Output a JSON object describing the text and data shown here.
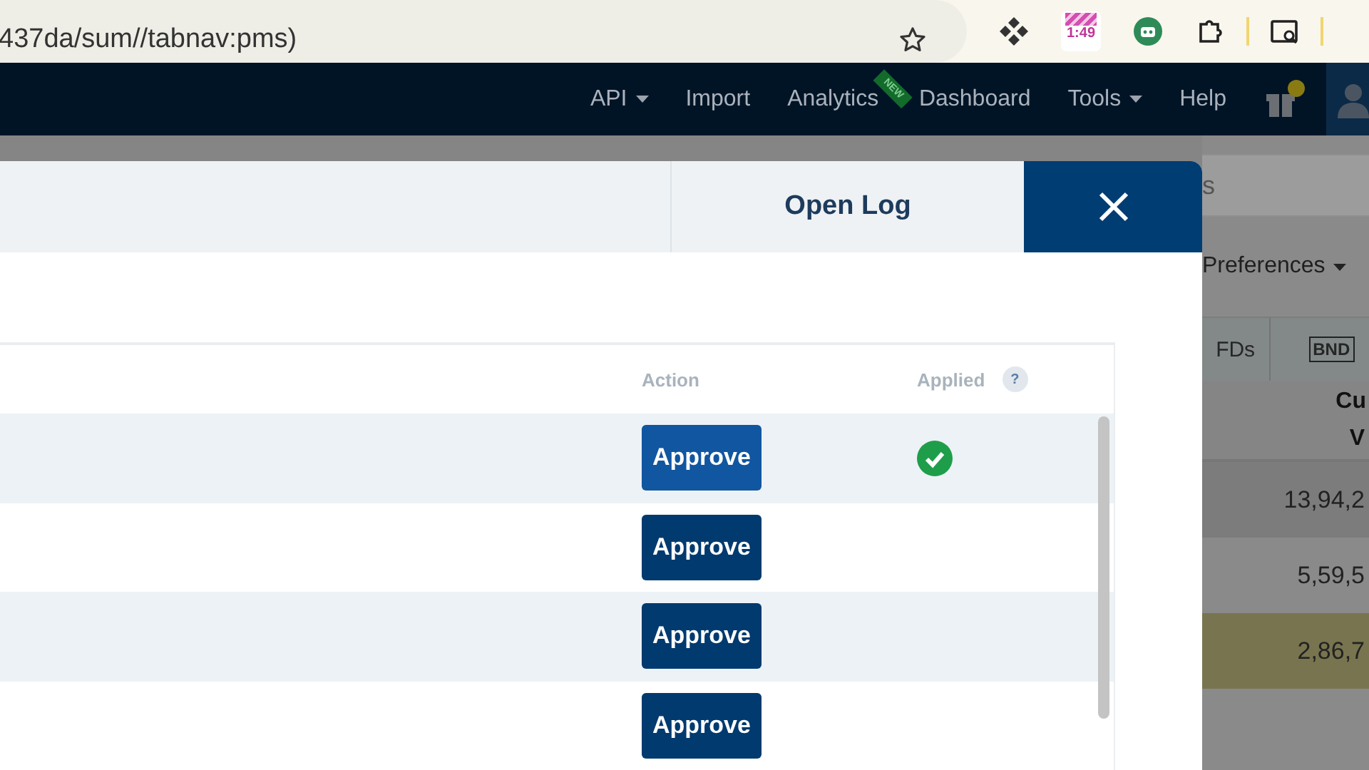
{
  "browser": {
    "url": "437da/sum//tabnav:pms)",
    "extension_badge": "1:49"
  },
  "nav": {
    "items": [
      {
        "label": "API",
        "kind": "dropdown"
      },
      {
        "label": "Import",
        "kind": "link"
      },
      {
        "label": "Analytics",
        "kind": "badged",
        "badge": "NEW"
      },
      {
        "label": "Dashboard",
        "kind": "link"
      },
      {
        "label": "Tools",
        "kind": "dropdown"
      },
      {
        "label": "Help",
        "kind": "link"
      }
    ]
  },
  "modal": {
    "tab": "Open Log",
    "columns": [
      {
        "label": "Action"
      },
      {
        "label": "Applied",
        "help": "?"
      }
    ],
    "rows": [
      {
        "action": "Approve",
        "hovered": true,
        "applied": true
      },
      {
        "action": "Approve",
        "hovered": false,
        "applied": false
      },
      {
        "action": "Approve",
        "hovered": false,
        "applied": false
      },
      {
        "action": "Approve",
        "hovered": false,
        "applied": false
      }
    ]
  },
  "background_page": {
    "search_text": "s",
    "menus": [
      "Preferences"
    ],
    "tabs": [
      "FDs",
      "BND"
    ],
    "header": [
      "Cu",
      "V"
    ],
    "rows": [
      {
        "value": "13,94,2",
        "highlighted": false
      },
      {
        "value": "5,59,5",
        "highlighted": false
      },
      {
        "value": "2,86,7",
        "highlighted": true
      }
    ]
  }
}
